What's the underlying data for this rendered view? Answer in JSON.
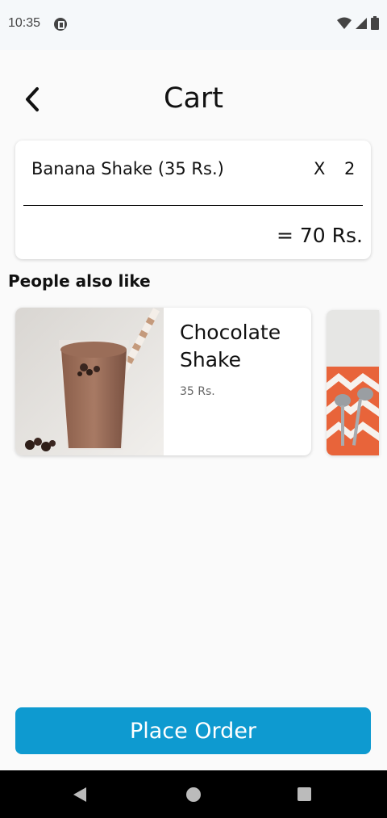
{
  "status_bar": {
    "time": "10:35",
    "icons": [
      "notification-icon",
      "wifi-icon",
      "signal-icon",
      "battery-icon"
    ]
  },
  "header": {
    "title": "Cart",
    "back_icon": "chevron-left-icon"
  },
  "cart": {
    "item_name": "Banana Shake (35 Rs.)",
    "multiplier": "X",
    "quantity": "2",
    "total": "= 70 Rs."
  },
  "suggestions": {
    "title": "People also like",
    "items": [
      {
        "name": "Chocolate Shake",
        "price": "35 Rs."
      }
    ]
  },
  "footer": {
    "place_order_label": "Place Order"
  },
  "colors": {
    "accent": "#0e9ad0",
    "background": "#fafafa"
  }
}
